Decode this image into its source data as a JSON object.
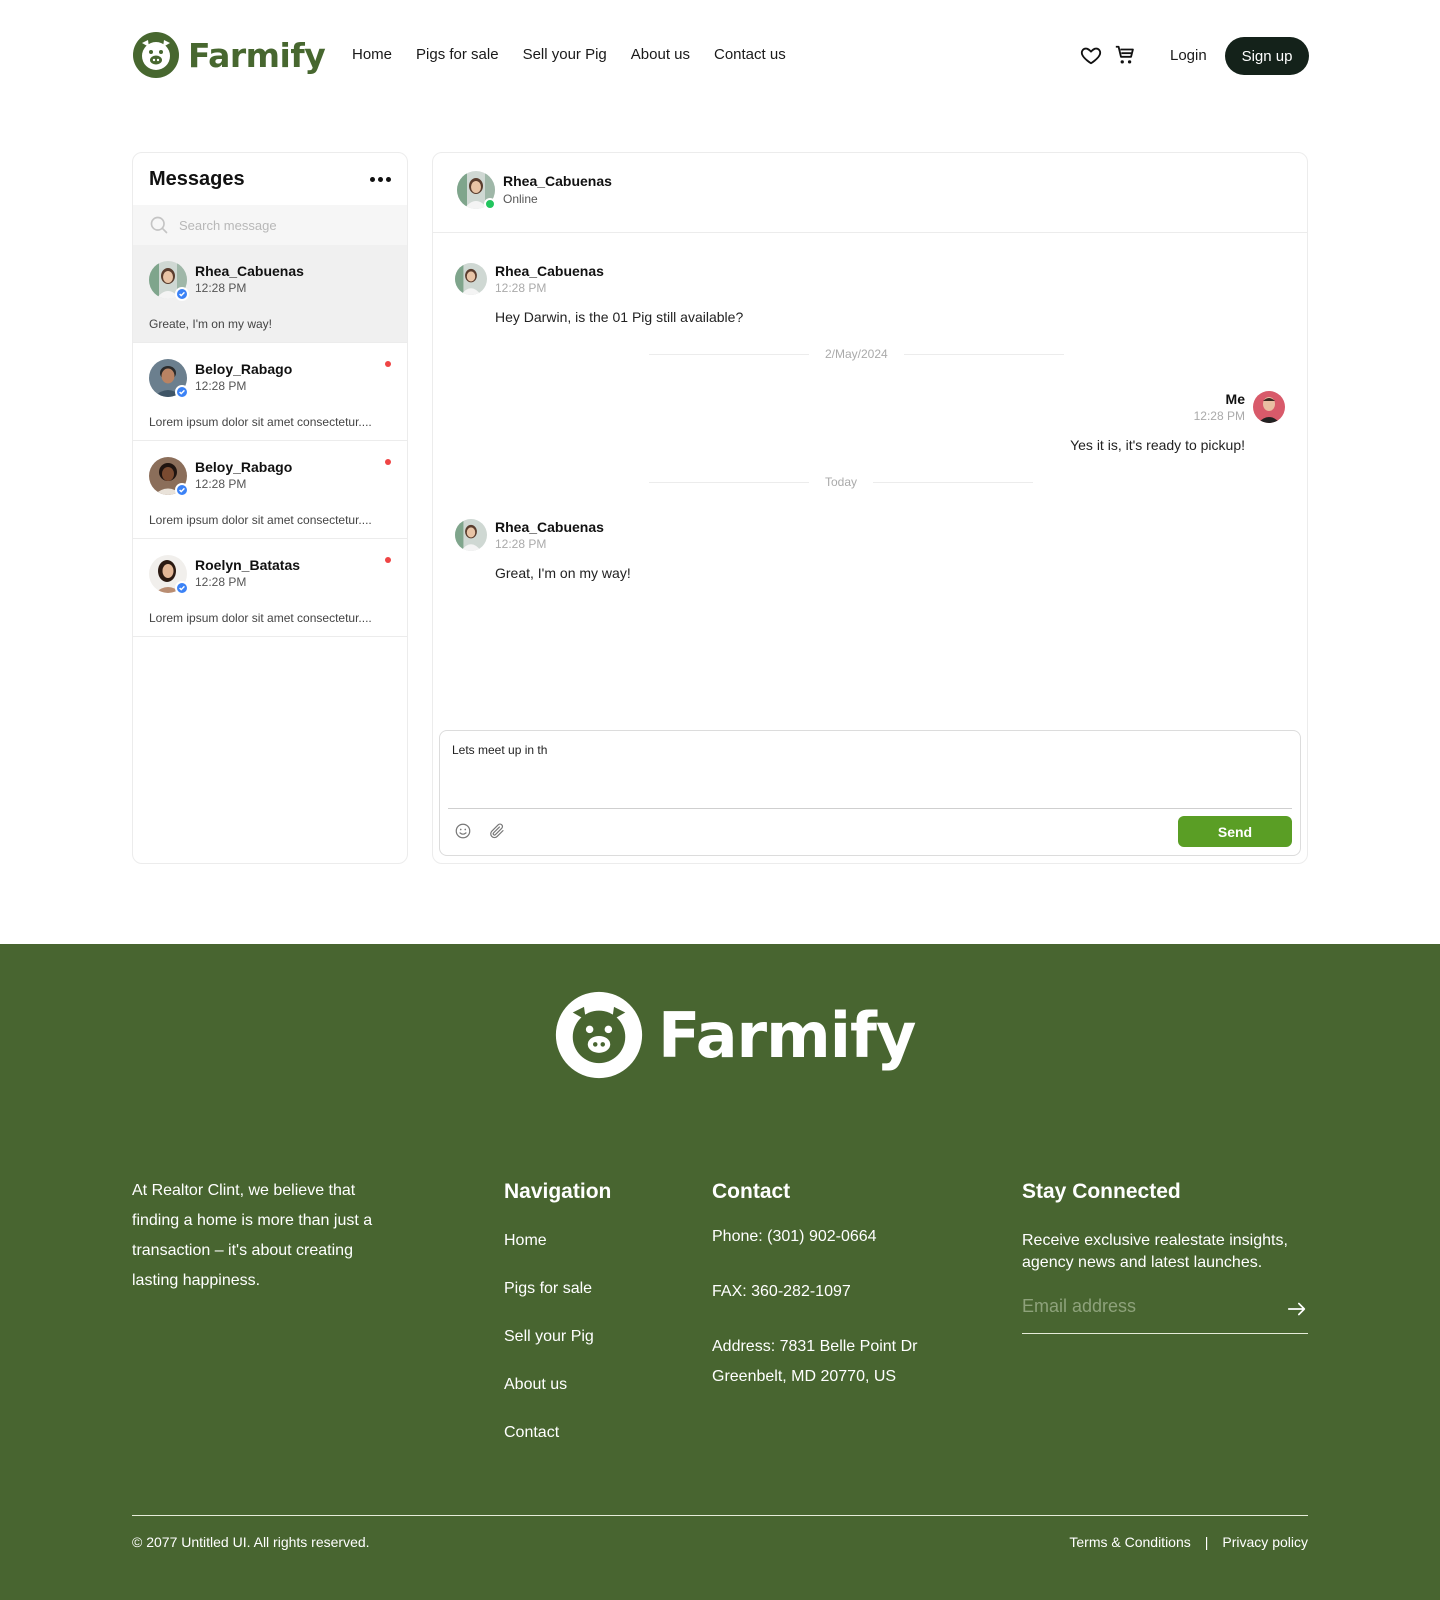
{
  "brand": {
    "name": "Farmify",
    "color": "#47672f"
  },
  "header": {
    "nav": [
      "Home",
      "Pigs for sale",
      "Sell your Pig",
      "About us",
      "Contact us"
    ],
    "login": "Login",
    "signup": "Sign up",
    "icons": [
      "heart-icon",
      "cart-icon"
    ]
  },
  "messages": {
    "title": "Messages",
    "search_placeholder": "Search message",
    "conversations": [
      {
        "name": "Rhea_Cabuenas",
        "time": "12:28 PM",
        "preview": "Greate, I'm on my way!",
        "active": true,
        "unread": false
      },
      {
        "name": "Beloy_Rabago",
        "time": "12:28 PM",
        "preview": "Lorem ipsum dolor sit amet consectetur....",
        "active": false,
        "unread": true
      },
      {
        "name": "Beloy_Rabago",
        "time": "12:28 PM",
        "preview": "Lorem ipsum dolor sit amet consectetur....",
        "active": false,
        "unread": true
      },
      {
        "name": "Roelyn_Batatas",
        "time": "12:28 PM",
        "preview": "Lorem ipsum dolor sit amet consectetur....",
        "active": false,
        "unread": true
      }
    ]
  },
  "chat": {
    "contact_name": "Rhea_Cabuenas",
    "contact_status": "Online",
    "messages": [
      {
        "sender": "Rhea_Cabuenas",
        "time": "12:28 PM",
        "text": "Hey Darwin, is the 01 Pig still available?"
      },
      {
        "sender": "Me",
        "time": "12:28 PM",
        "text": "Yes it is, it's ready to pickup!"
      },
      {
        "sender": "Rhea_Cabuenas",
        "time": "12:28 PM",
        "text": "Great, I'm on my way!"
      }
    ],
    "dividers": [
      "2/May/2024",
      "Today"
    ],
    "composer_value": "Lets meet up in th",
    "send_label": "Send"
  },
  "footer": {
    "about": "At Realtor Clint, we believe that finding a home is more than just a transaction – it's about creating lasting happiness.",
    "navigation_title": "Navigation",
    "navigation": [
      "Home",
      "Pigs for sale",
      "Sell your Pig",
      "About us",
      "Contact"
    ],
    "contact_title": "Contact",
    "phone": "Phone: (301) 902-0664",
    "fax": "FAX: 360-282-1097",
    "address_line1": "Address: 7831 Belle Point Dr",
    "address_line2": "Greenbelt, MD 20770, US",
    "stay_title": "Stay Connected",
    "stay_desc": "Receive exclusive realestate insights, agency news and latest launches.",
    "email_placeholder": "Email address",
    "copyright": "© 2077 Untitled UI. All rights reserved.",
    "terms": "Terms & Conditions",
    "separator": "|",
    "privacy": "Privacy policy",
    "bg_color": "#486530"
  }
}
